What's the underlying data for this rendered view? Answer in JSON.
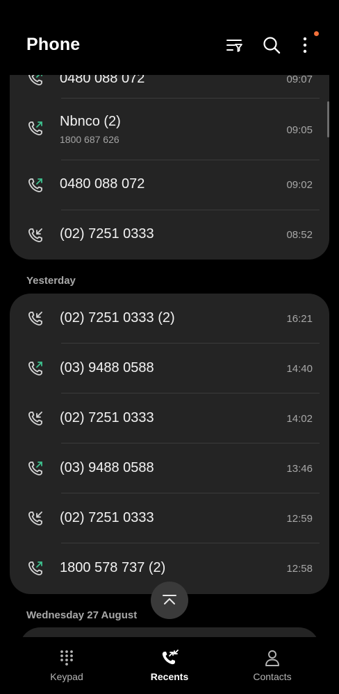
{
  "header": {
    "title": "Phone",
    "icons": {
      "filter": "filter-icon",
      "search": "search-icon",
      "more": "more-options-icon"
    },
    "notification_dot_color": "#f2703a"
  },
  "groups": [
    {
      "label": "",
      "calls": [
        {
          "number": "0480 088 072",
          "time": "09:07",
          "type": "outgoing"
        },
        {
          "number": "Nbnco (2)",
          "subtitle": "1800 687 626",
          "time": "09:05",
          "type": "outgoing"
        },
        {
          "number": "0480 088 072",
          "time": "09:02",
          "type": "outgoing"
        },
        {
          "number": "(02) 7251 0333",
          "time": "08:52",
          "type": "incoming"
        }
      ]
    },
    {
      "label": "Yesterday",
      "calls": [
        {
          "number": "(02) 7251 0333 (2)",
          "time": "16:21",
          "type": "incoming"
        },
        {
          "number": "(03) 9488 0588",
          "time": "14:40",
          "type": "outgoing"
        },
        {
          "number": "(02) 7251 0333",
          "time": "14:02",
          "type": "incoming"
        },
        {
          "number": "(03) 9488 0588",
          "time": "13:46",
          "type": "outgoing"
        },
        {
          "number": "(02) 7251 0333",
          "time": "12:59",
          "type": "incoming"
        },
        {
          "number": "1800 578 737 (2)",
          "time": "12:58",
          "type": "outgoing"
        }
      ]
    },
    {
      "label": "Wednesday 27 August",
      "calls": []
    }
  ],
  "colors": {
    "outgoing_arrow": "#3ec28f",
    "incoming_arrow": "#d6d6d6",
    "card": "#242424"
  },
  "scroll_to_top": {
    "icon": "chevrons-up-icon"
  },
  "bottom_nav": {
    "items": [
      {
        "label": "Keypad",
        "icon": "keypad-icon",
        "active": false
      },
      {
        "label": "Recents",
        "icon": "recents-icon",
        "active": true
      },
      {
        "label": "Contacts",
        "icon": "contacts-icon",
        "active": false
      }
    ]
  }
}
